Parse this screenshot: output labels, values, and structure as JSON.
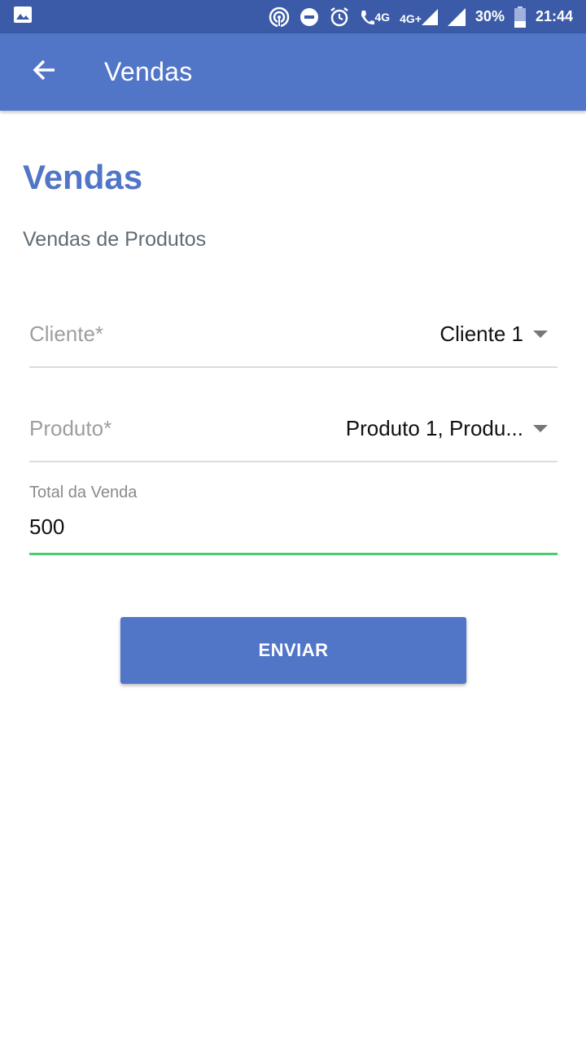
{
  "status_bar": {
    "network_4g_small": "4G",
    "network_4g_plus": "4G+",
    "battery": "30%",
    "time": "21:44",
    "icons": [
      "image-icon",
      "hotspot-icon",
      "do-not-disturb-icon",
      "alarm-icon",
      "volte-call-icon",
      "signal-icon",
      "signal-icon",
      "battery-icon"
    ]
  },
  "app_bar": {
    "title": "Vendas",
    "back_icon": "arrow-back-icon"
  },
  "page": {
    "title": "Vendas",
    "subtitle": "Vendas de Produtos"
  },
  "form": {
    "cliente": {
      "label": "Cliente*",
      "value": "Cliente 1"
    },
    "produto": {
      "label": "Produto*",
      "value": "Produto 1, Produ..."
    },
    "total": {
      "label": "Total da Venda",
      "value": "500"
    },
    "submit_label": "ENVIAR"
  },
  "colors": {
    "status_bar": "#3b5ba8",
    "primary": "#5175c7",
    "focus_underline": "#4ccc6e",
    "subtitle": "#5f6b75"
  }
}
